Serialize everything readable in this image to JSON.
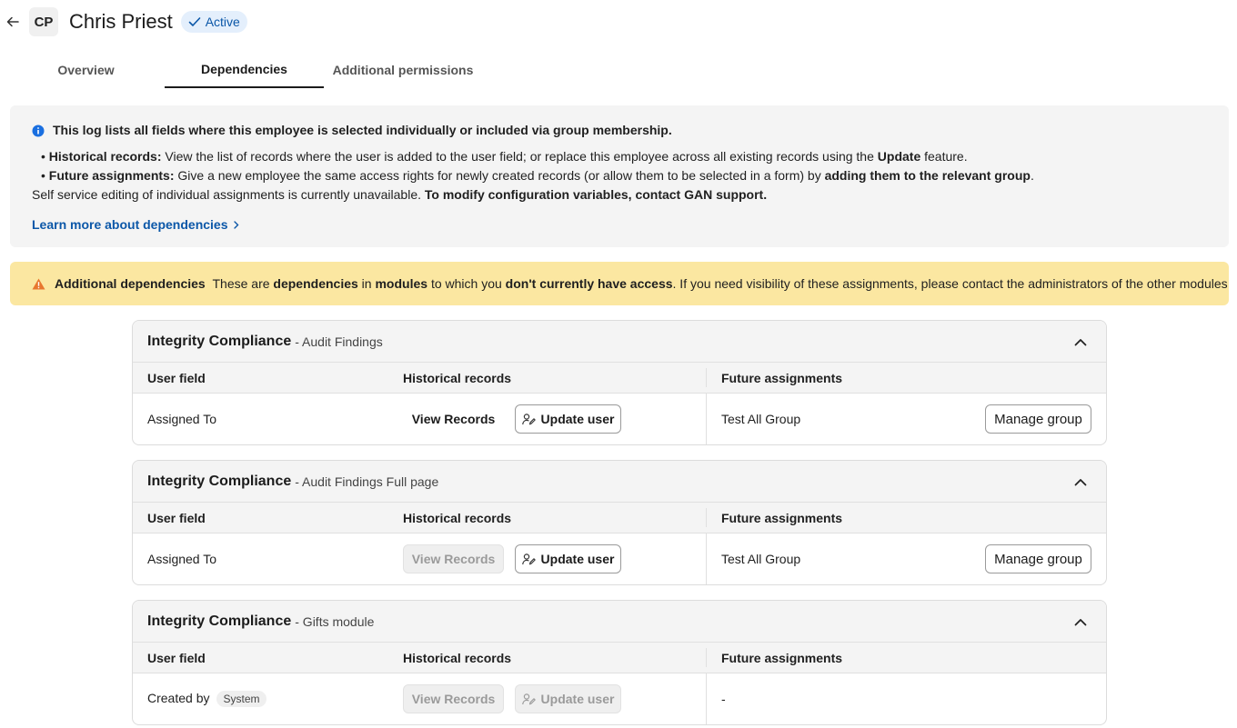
{
  "header": {
    "avatar_initials": "CP",
    "name": "Chris Priest",
    "status": "Active"
  },
  "tabs": [
    {
      "label": "Overview",
      "active": false
    },
    {
      "label": "Dependencies",
      "active": true
    },
    {
      "label": "Additional permissions",
      "active": false
    }
  ],
  "info": {
    "title": "This log lists all fields where this employee is selected individually or included via group membership.",
    "historical_label": "Historical records:",
    "historical_text": " View the list of records where the user is added to the user field; or replace this employee across all existing records using the ",
    "historical_bold": "Update",
    "historical_tail": " feature.",
    "future_label": "Future assignments:",
    "future_text": " Give a new employee the same access rights for newly created records (or allow them to be selected in a form) by ",
    "future_bold": "adding them to the relevant group",
    "future_tail": ".",
    "self_service_text": "Self service editing of individual assignments is currently unavailable. ",
    "self_service_bold": "To modify configuration variables, contact GAN support.",
    "learn_more": "Learn more about dependencies"
  },
  "warning": {
    "title": "Additional dependencies",
    "t1": "These are ",
    "b1": "dependencies",
    "t2": " in ",
    "b2": "modules",
    "t3": " to which you ",
    "b3": "don't currently have access",
    "t4": ". If you need visibility of these assignments, please contact the administrators of the other modules"
  },
  "columns": {
    "user_field": "User field",
    "historical": "Historical records",
    "future": "Future assignments"
  },
  "modules": [
    {
      "name": "Integrity Compliance",
      "sub": "- Audit Findings",
      "field": "Assigned To",
      "field_badge": "",
      "view_label": "View Records",
      "update_label": "Update user",
      "future_value": "Test All Group",
      "manage_label": "Manage group"
    },
    {
      "name": "Integrity Compliance",
      "sub": "- Audit Findings Full page",
      "field": "Assigned To",
      "field_badge": "",
      "view_label": "View Records",
      "update_label": "Update user",
      "future_value": "Test All Group",
      "manage_label": "Manage group"
    },
    {
      "name": "Integrity Compliance",
      "sub": "- Gifts module",
      "field": "Created by",
      "field_badge": "System",
      "view_label": "View Records",
      "update_label": "Update user",
      "future_value": "-",
      "manage_label": ""
    }
  ],
  "colors": {
    "accent": "#0b57a8",
    "info_bg": "#f4f4f4",
    "warning_bg": "#fbe7a1",
    "warning_icon": "#e8772e"
  },
  "icons": {
    "back": "arrow-left-icon",
    "status": "check-icon",
    "info": "info-icon",
    "learn": "chevron-right-icon",
    "warning": "warning-triangle-icon",
    "collapse": "chevron-up-icon",
    "update": "user-edit-icon"
  }
}
